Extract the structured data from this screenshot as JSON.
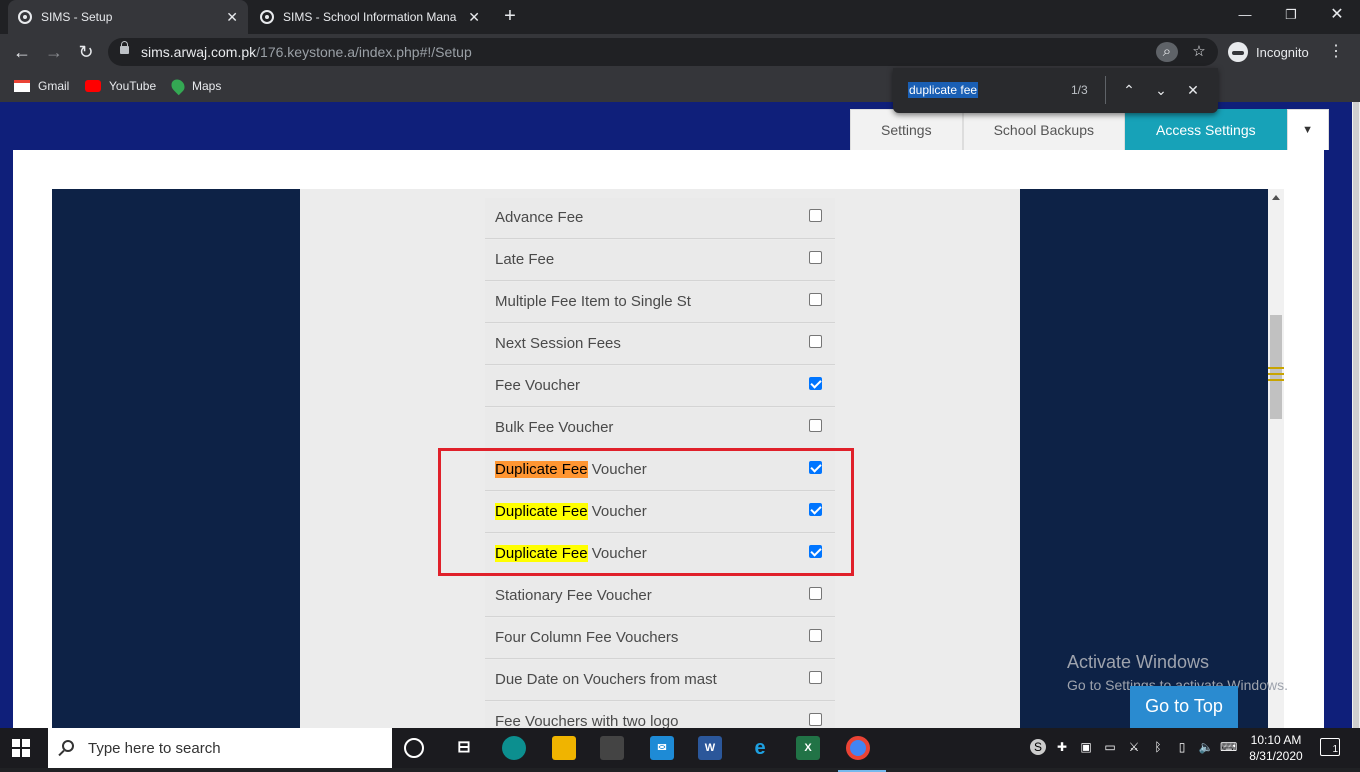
{
  "browser": {
    "tabs": [
      {
        "title": "SIMS - Setup"
      },
      {
        "title": "SIMS - School Information Mana"
      }
    ],
    "url_domain": "sims.arwaj.com.pk",
    "url_path": "/176.keystone.a/index.php#!/Setup",
    "incognito_label": "Incognito",
    "bookmarks": [
      {
        "label": "Gmail",
        "icon": "gmail-icon",
        "color": "#ea4335"
      },
      {
        "label": "YouTube",
        "icon": "youtube-icon",
        "color": "#ff0000"
      },
      {
        "label": "Maps",
        "icon": "maps-icon",
        "color": "#34a853"
      }
    ],
    "find": {
      "query": "duplicate fee",
      "count": "1/3"
    }
  },
  "page": {
    "tabs": [
      {
        "label": "Settings",
        "active": false
      },
      {
        "label": "School Backups",
        "active": false
      },
      {
        "label": "Access Settings",
        "active": true
      }
    ],
    "accent_color": "#17a2b8",
    "settings": [
      {
        "label": "Advance Fee",
        "checked": false
      },
      {
        "label": "Late Fee",
        "checked": false
      },
      {
        "label": "Multiple Fee Item to Single St",
        "checked": false
      },
      {
        "label": "Next Session Fees",
        "checked": false
      },
      {
        "label": "Fee Voucher",
        "checked": true
      },
      {
        "label": "Bulk Fee Voucher",
        "checked": false
      },
      {
        "highlight": "Duplicate Fee",
        "rest": " Voucher",
        "current": true,
        "checked": true
      },
      {
        "highlight": "Duplicate Fee",
        "rest": " Voucher",
        "current": false,
        "checked": true
      },
      {
        "highlight": "Duplicate Fee",
        "rest": " Voucher",
        "current": false,
        "checked": true
      },
      {
        "label": "Stationary Fee Voucher",
        "checked": false
      },
      {
        "label": "Four Column Fee Vouchers",
        "checked": false
      },
      {
        "label": "Due Date on Vouchers from mast",
        "checked": false
      },
      {
        "label": "Fee Vouchers with two logo",
        "checked": false
      }
    ],
    "activate_windows": {
      "title": "Activate Windows",
      "subtitle": "Go to Settings to activate Windows."
    },
    "go_to_top": "Go to Top"
  },
  "taskbar": {
    "search_placeholder": "Type here to search",
    "time": "10:10 AM",
    "date": "8/31/2020",
    "notifications": "1"
  }
}
